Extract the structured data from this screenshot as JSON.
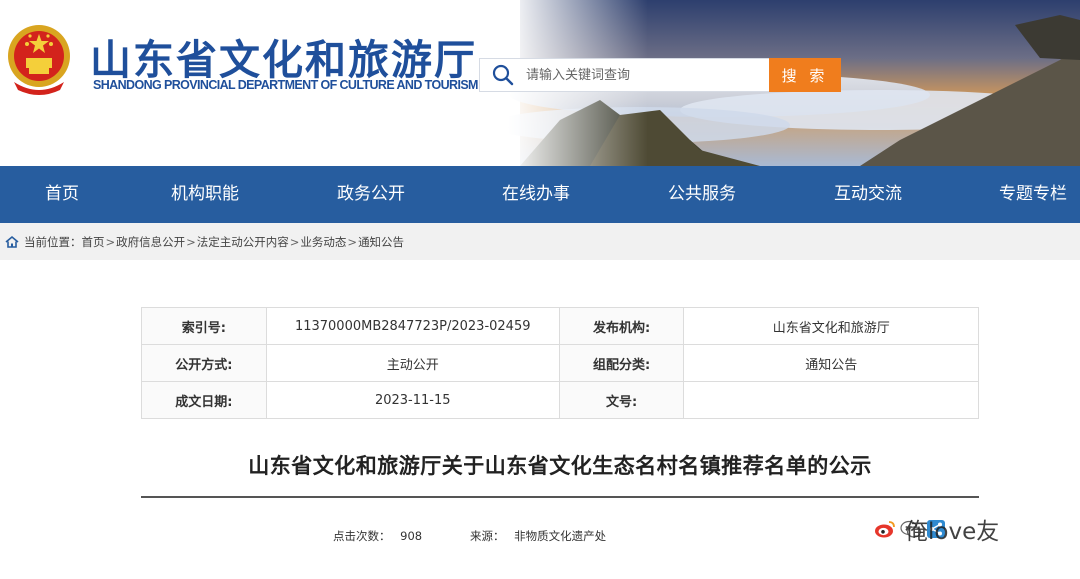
{
  "header": {
    "site_title": "山东省文化和旅游厅",
    "site_subtitle": "SHANDONG PROVINCIAL DEPARTMENT OF CULTURE AND TOURISM",
    "search_placeholder": "请输入关键词查询",
    "search_button_label": "搜 索"
  },
  "nav": {
    "items": [
      {
        "label": "首页"
      },
      {
        "label": "机构职能"
      },
      {
        "label": "政务公开"
      },
      {
        "label": "在线办事"
      },
      {
        "label": "公共服务"
      },
      {
        "label": "互动交流"
      },
      {
        "label": "专题专栏"
      }
    ]
  },
  "breadcrumb": {
    "prefix": "当前位置：",
    "items": [
      "首页",
      "政府信息公开",
      "法定主动公开内容",
      "业务动态",
      "通知公告"
    ],
    "separator": ">"
  },
  "info_table": {
    "rows": [
      {
        "label1": "索引号:",
        "value1": "11370000MB2847723P/2023-02459",
        "label2": "发布机构:",
        "value2": "山东省文化和旅游厅"
      },
      {
        "label1": "公开方式:",
        "value1": "主动公开",
        "label2": "组配分类:",
        "value2": "通知公告"
      },
      {
        "label1": "成文日期:",
        "value1": "2023-11-15",
        "label2": "文号:",
        "value2": ""
      }
    ]
  },
  "article": {
    "title": "山东省文化和旅游厅关于山东省文化生态名村名镇推荐名单的公示",
    "views_label": "点击次数：",
    "views_value": "908",
    "source_label": "来源：",
    "source_value": "非物质文化遗产处"
  },
  "watermark": "俺love友",
  "colors": {
    "brand_blue": "#1f4f9b",
    "nav_blue": "#275d9f",
    "search_orange": "#f07d1d"
  },
  "icons": [
    "national-emblem-icon",
    "search-icon",
    "home-icon",
    "weibo-icon",
    "wechat-icon",
    "share-icon"
  ]
}
